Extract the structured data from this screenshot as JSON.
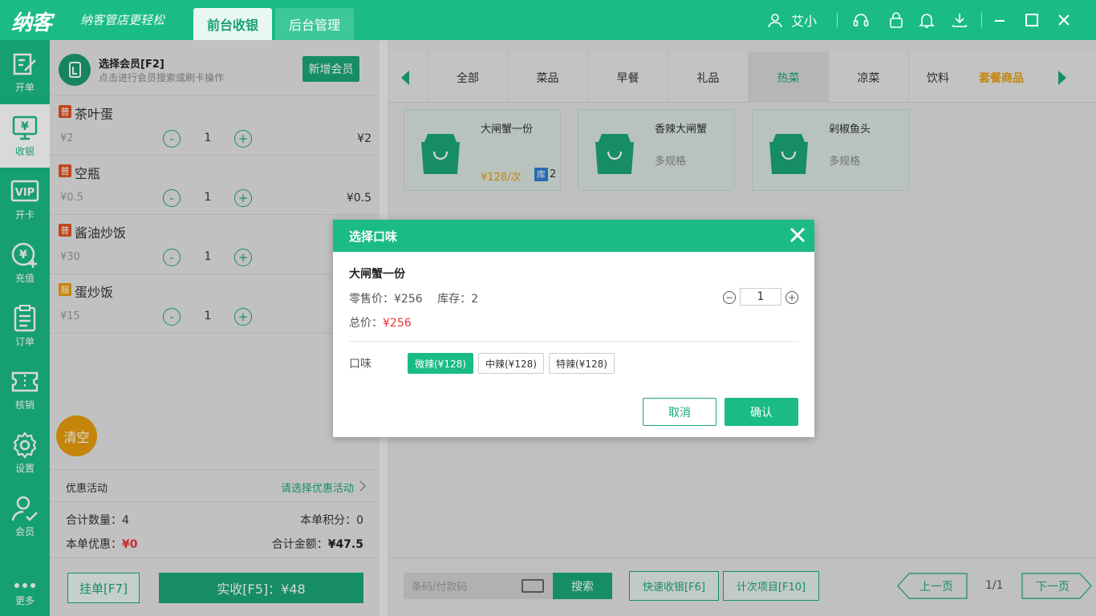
{
  "header": {
    "logo": "纳客",
    "slogan": "纳客管店更轻松",
    "tabs": [
      {
        "label": "前台收银"
      },
      {
        "label": "后台管理"
      }
    ],
    "user_name": "艾小"
  },
  "sidebar": {
    "items": [
      {
        "label": "开单"
      },
      {
        "label": "收银"
      },
      {
        "label": "开卡"
      },
      {
        "label": "充值"
      },
      {
        "label": "订单"
      },
      {
        "label": "核销"
      },
      {
        "label": "设置"
      },
      {
        "label": "会员"
      },
      {
        "label": "更多"
      }
    ]
  },
  "member": {
    "title": "选择会员[F2]",
    "hint": "点击进行会员搜索或刷卡操作",
    "add_button": "新增会员"
  },
  "order_items": [
    {
      "badge": "普",
      "badge_color": "#e0531f",
      "name": "茶叶蛋",
      "price": "¥2",
      "qty": "1",
      "subtotal": "¥2"
    },
    {
      "badge": "普",
      "badge_color": "#e0531f",
      "name": "空瓶",
      "price": "¥0.5",
      "qty": "1",
      "subtotal": "¥0.5"
    },
    {
      "badge": "普",
      "badge_color": "#e0531f",
      "name": "酱油炒饭",
      "price": "¥30",
      "qty": "1",
      "subtotal": ""
    },
    {
      "badge": "服",
      "badge_color": "#e89d0d",
      "name": "蛋炒饭",
      "price": "¥15",
      "qty": "1",
      "subtotal": ""
    }
  ],
  "clear_button": "清空",
  "promotion": {
    "label": "优惠活动",
    "link": "请选择优惠活动"
  },
  "summary": {
    "qty_label": "合计数量：",
    "qty": "4",
    "points_label": "本单积分：",
    "points": "0",
    "discount_label": "本单优惠：",
    "discount": "¥0",
    "total_label": "合计金额：",
    "total": "¥47.5"
  },
  "actions": {
    "hang": "挂单[F7]",
    "pay": "实收[F5]：¥48"
  },
  "categories": [
    {
      "label": "全部"
    },
    {
      "label": "菜品"
    },
    {
      "label": "早餐"
    },
    {
      "label": "礼品"
    },
    {
      "label": "热菜"
    },
    {
      "label": "凉菜"
    },
    {
      "label": "饮料"
    },
    {
      "label": "套餐商品"
    }
  ],
  "products": [
    {
      "name": "大闸蟹一份",
      "price": "¥128/次",
      "stock_badge": "库",
      "stock": "2",
      "meta": ""
    },
    {
      "name": "香辣大闸蟹",
      "meta": "多规格"
    },
    {
      "name": "剁椒鱼头",
      "meta": "多规格"
    }
  ],
  "bottom": {
    "scan_placeholder": "条码/付款码",
    "search": "搜索",
    "quick_cash": "快速收银[F6]",
    "count_items": "计次项目[F10]",
    "prev": "上一页",
    "page": "1/1",
    "next": "下一页"
  },
  "dialog": {
    "title": "选择口味",
    "product_name": "大闸蟹一份",
    "retail_label": "零售价：",
    "retail_price": "¥256",
    "stock_label": "库存：",
    "stock": "2",
    "qty": "1",
    "total_label": "总价：",
    "total": "¥256",
    "flavor_label": "口味",
    "flavors": [
      "微辣(¥128)",
      "中辣(¥128)",
      "特辣(¥128)"
    ],
    "cancel": "取消",
    "confirm": "确认"
  },
  "colors": {
    "brand": "#1bbb85",
    "accent_orange": "#e89d0d",
    "price_red": "#e8343a"
  }
}
